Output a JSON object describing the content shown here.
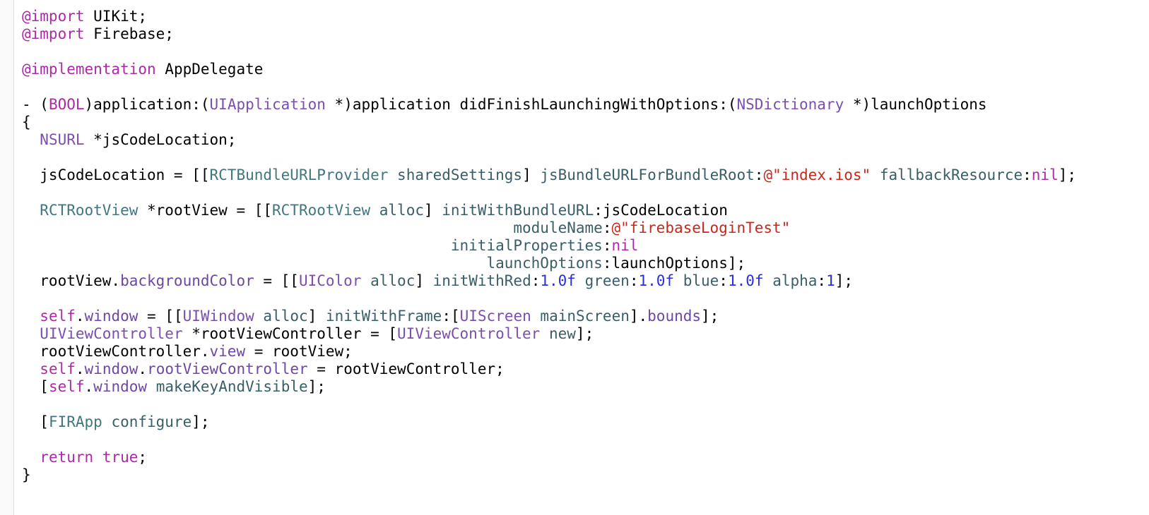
{
  "editor": {
    "language": "Objective-C",
    "colors": {
      "background": "#ffffff",
      "gutter": "#f9f9f9",
      "plain": "#000000",
      "keyword": "#ab2aa6",
      "class": "#7a4fad",
      "projclass": "#42767e",
      "method": "#3a5e67",
      "string": "#c8281c",
      "number": "#2931d6",
      "property": "#6d47a6"
    },
    "lines": [
      [
        {
          "t": "keyword",
          "s": "@import"
        },
        {
          "t": "plain",
          "s": " UIKit;"
        }
      ],
      [
        {
          "t": "keyword",
          "s": "@import"
        },
        {
          "t": "plain",
          "s": " Firebase;"
        }
      ],
      [],
      [
        {
          "t": "keyword",
          "s": "@implementation"
        },
        {
          "t": "plain",
          "s": " AppDelegate"
        }
      ],
      [],
      [
        {
          "t": "plain",
          "s": "- ("
        },
        {
          "t": "keyword",
          "s": "BOOL"
        },
        {
          "t": "plain",
          "s": ")application:("
        },
        {
          "t": "class",
          "s": "UIApplication"
        },
        {
          "t": "plain",
          "s": " *)application didFinishLaunchingWithOptions:("
        },
        {
          "t": "class",
          "s": "NSDictionary"
        },
        {
          "t": "plain",
          "s": " *)launchOptions"
        }
      ],
      [
        {
          "t": "plain",
          "s": "{"
        }
      ],
      [
        {
          "t": "plain",
          "s": "  "
        },
        {
          "t": "class",
          "s": "NSURL"
        },
        {
          "t": "plain",
          "s": " *jsCodeLocation;"
        }
      ],
      [],
      [
        {
          "t": "plain",
          "s": "  jsCodeLocation = [["
        },
        {
          "t": "projclass",
          "s": "RCTBundleURLProvider"
        },
        {
          "t": "plain",
          "s": " "
        },
        {
          "t": "method",
          "s": "sharedSettings"
        },
        {
          "t": "plain",
          "s": "] "
        },
        {
          "t": "method",
          "s": "jsBundleURLForBundleRoot"
        },
        {
          "t": "plain",
          "s": ":"
        },
        {
          "t": "string",
          "s": "@\"index.ios\""
        },
        {
          "t": "plain",
          "s": " "
        },
        {
          "t": "method",
          "s": "fallbackResource"
        },
        {
          "t": "plain",
          "s": ":"
        },
        {
          "t": "keyword",
          "s": "nil"
        },
        {
          "t": "plain",
          "s": "];"
        }
      ],
      [],
      [
        {
          "t": "plain",
          "s": "  "
        },
        {
          "t": "projclass",
          "s": "RCTRootView"
        },
        {
          "t": "plain",
          "s": " *rootView = [["
        },
        {
          "t": "projclass",
          "s": "RCTRootView"
        },
        {
          "t": "plain",
          "s": " "
        },
        {
          "t": "method",
          "s": "alloc"
        },
        {
          "t": "plain",
          "s": "] "
        },
        {
          "t": "method",
          "s": "initWithBundleURL"
        },
        {
          "t": "plain",
          "s": ":jsCodeLocation"
        }
      ],
      [
        {
          "t": "plain",
          "s": "                                                       "
        },
        {
          "t": "method",
          "s": "moduleName"
        },
        {
          "t": "plain",
          "s": ":"
        },
        {
          "t": "string",
          "s": "@\"firebaseLoginTest\""
        }
      ],
      [
        {
          "t": "plain",
          "s": "                                                "
        },
        {
          "t": "method",
          "s": "initialProperties"
        },
        {
          "t": "plain",
          "s": ":"
        },
        {
          "t": "keyword",
          "s": "nil"
        }
      ],
      [
        {
          "t": "plain",
          "s": "                                                    "
        },
        {
          "t": "method",
          "s": "launchOptions"
        },
        {
          "t": "plain",
          "s": ":launchOptions];"
        }
      ],
      [
        {
          "t": "plain",
          "s": "  rootView."
        },
        {
          "t": "property",
          "s": "backgroundColor"
        },
        {
          "t": "plain",
          "s": " = [["
        },
        {
          "t": "class",
          "s": "UIColor"
        },
        {
          "t": "plain",
          "s": " "
        },
        {
          "t": "method",
          "s": "alloc"
        },
        {
          "t": "plain",
          "s": "] "
        },
        {
          "t": "method",
          "s": "initWithRed"
        },
        {
          "t": "plain",
          "s": ":"
        },
        {
          "t": "number",
          "s": "1.0f"
        },
        {
          "t": "plain",
          "s": " "
        },
        {
          "t": "method",
          "s": "green"
        },
        {
          "t": "plain",
          "s": ":"
        },
        {
          "t": "number",
          "s": "1.0f"
        },
        {
          "t": "plain",
          "s": " "
        },
        {
          "t": "method",
          "s": "blue"
        },
        {
          "t": "plain",
          "s": ":"
        },
        {
          "t": "number",
          "s": "1.0f"
        },
        {
          "t": "plain",
          "s": " "
        },
        {
          "t": "method",
          "s": "alpha"
        },
        {
          "t": "plain",
          "s": ":"
        },
        {
          "t": "number",
          "s": "1"
        },
        {
          "t": "plain",
          "s": "];"
        }
      ],
      [],
      [
        {
          "t": "plain",
          "s": "  "
        },
        {
          "t": "keyword",
          "s": "self"
        },
        {
          "t": "plain",
          "s": "."
        },
        {
          "t": "property",
          "s": "window"
        },
        {
          "t": "plain",
          "s": " = [["
        },
        {
          "t": "class",
          "s": "UIWindow"
        },
        {
          "t": "plain",
          "s": " "
        },
        {
          "t": "method",
          "s": "alloc"
        },
        {
          "t": "plain",
          "s": "] "
        },
        {
          "t": "method",
          "s": "initWithFrame"
        },
        {
          "t": "plain",
          "s": ":["
        },
        {
          "t": "class",
          "s": "UIScreen"
        },
        {
          "t": "plain",
          "s": " "
        },
        {
          "t": "method",
          "s": "mainScreen"
        },
        {
          "t": "plain",
          "s": "]."
        },
        {
          "t": "property",
          "s": "bounds"
        },
        {
          "t": "plain",
          "s": "];"
        }
      ],
      [
        {
          "t": "plain",
          "s": "  "
        },
        {
          "t": "class",
          "s": "UIViewController"
        },
        {
          "t": "plain",
          "s": " *rootViewController = ["
        },
        {
          "t": "class",
          "s": "UIViewController"
        },
        {
          "t": "plain",
          "s": " "
        },
        {
          "t": "method",
          "s": "new"
        },
        {
          "t": "plain",
          "s": "];"
        }
      ],
      [
        {
          "t": "plain",
          "s": "  rootViewController."
        },
        {
          "t": "property",
          "s": "view"
        },
        {
          "t": "plain",
          "s": " = rootView;"
        }
      ],
      [
        {
          "t": "plain",
          "s": "  "
        },
        {
          "t": "keyword",
          "s": "self"
        },
        {
          "t": "plain",
          "s": "."
        },
        {
          "t": "property",
          "s": "window"
        },
        {
          "t": "plain",
          "s": "."
        },
        {
          "t": "property",
          "s": "rootViewController"
        },
        {
          "t": "plain",
          "s": " = rootViewController;"
        }
      ],
      [
        {
          "t": "plain",
          "s": "  ["
        },
        {
          "t": "keyword",
          "s": "self"
        },
        {
          "t": "plain",
          "s": "."
        },
        {
          "t": "property",
          "s": "window"
        },
        {
          "t": "plain",
          "s": " "
        },
        {
          "t": "method",
          "s": "makeKeyAndVisible"
        },
        {
          "t": "plain",
          "s": "];"
        }
      ],
      [],
      [
        {
          "t": "plain",
          "s": "  ["
        },
        {
          "t": "projclass",
          "s": "FIRApp"
        },
        {
          "t": "plain",
          "s": " "
        },
        {
          "t": "method",
          "s": "configure"
        },
        {
          "t": "plain",
          "s": "];"
        }
      ],
      [],
      [
        {
          "t": "plain",
          "s": "  "
        },
        {
          "t": "keyword",
          "s": "return"
        },
        {
          "t": "plain",
          "s": " "
        },
        {
          "t": "keyword",
          "s": "true"
        },
        {
          "t": "plain",
          "s": ";"
        }
      ],
      [
        {
          "t": "plain",
          "s": "}"
        }
      ]
    ]
  }
}
